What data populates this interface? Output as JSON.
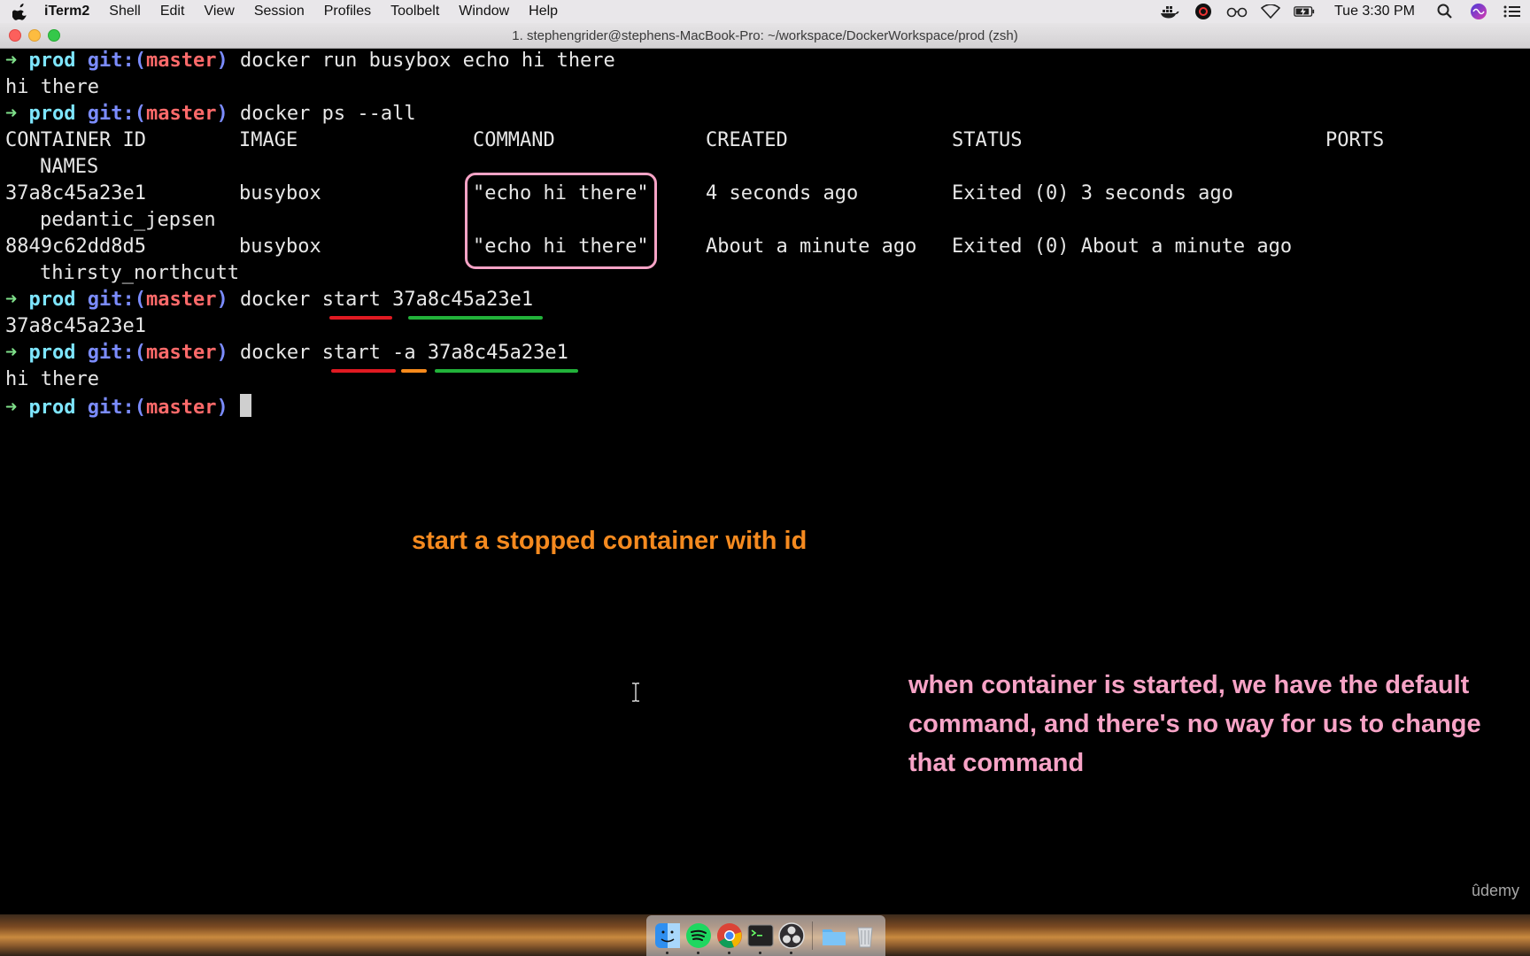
{
  "menubar": {
    "app": "iTerm2",
    "items": [
      "Shell",
      "Edit",
      "View",
      "Session",
      "Profiles",
      "Toolbelt",
      "Window",
      "Help"
    ],
    "clock": "Tue 3:30 PM",
    "status_icons": [
      "docker-icon",
      "creative-cloud-icon",
      "glasses-icon",
      "wifi-icon",
      "battery-icon",
      "search-icon",
      "siri-icon",
      "notification-center-icon"
    ]
  },
  "window": {
    "title": "1. stephengrider@stephens-MacBook-Pro: ~/workspace/DockerWorkspace/prod (zsh)"
  },
  "prompt": {
    "arrow": "➜",
    "dir": "prod",
    "git_open": "git:(",
    "branch": "master",
    "git_close": ")"
  },
  "terminal": {
    "cmd1": "docker run busybox echo hi there",
    "out1": "hi there",
    "cmd2": "docker ps --all",
    "table_headers": {
      "container_id": "CONTAINER ID",
      "image": "IMAGE",
      "command": "COMMAND",
      "created": "CREATED",
      "status": "STATUS",
      "ports": "PORTS",
      "names": "NAMES"
    },
    "rows": [
      {
        "container_id": "37a8c45a23e1",
        "image": "busybox",
        "command": "\"echo hi there\"",
        "created": "4 seconds ago",
        "status": "Exited (0) 3 seconds ago",
        "names": "pedantic_jepsen"
      },
      {
        "container_id": "8849c62dd8d5",
        "image": "busybox",
        "command": "\"echo hi there\"",
        "created": "About a minute ago",
        "status": "Exited (0) About a minute ago",
        "names": "thirsty_northcutt"
      }
    ],
    "cmd3": {
      "docker": "docker",
      "start": "start",
      "id": "37a8c45a23e1"
    },
    "out3": "37a8c45a23e1",
    "cmd4": {
      "docker": "docker",
      "start": "start",
      "flag": "-a",
      "id": "37a8c45a23e1"
    },
    "out4": "hi there"
  },
  "annotations": {
    "orange": "start a stopped container with id",
    "pink": "when container is started, we have the default command, and there's no way for us to change that command",
    "colors": {
      "orange": "#f58a1f",
      "pink": "#f7a3c6",
      "red": "#e01a22",
      "green": "#22b23a"
    }
  },
  "watermark": "ûdemy",
  "dock": {
    "icons": [
      "finder-icon",
      "spotify-icon",
      "chrome-icon",
      "terminal-icon",
      "obs-icon",
      "folder-icon",
      "trash-icon"
    ]
  }
}
